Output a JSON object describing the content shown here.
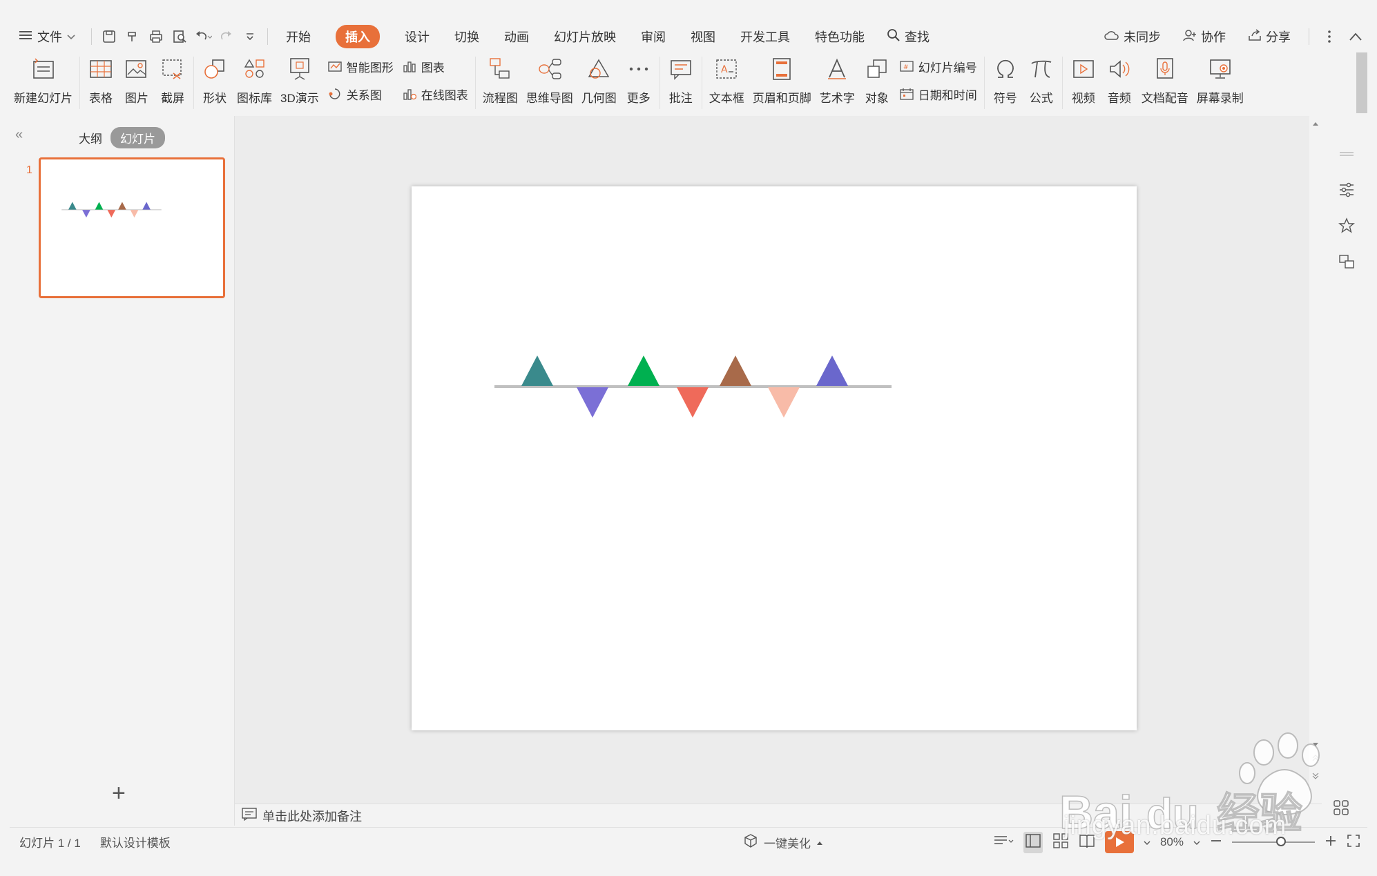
{
  "menu": {
    "file_label": "文件",
    "tabs": [
      "开始",
      "插入",
      "设计",
      "切换",
      "动画",
      "幻灯片放映",
      "审阅",
      "视图",
      "开发工具",
      "特色功能"
    ],
    "active_tab": "插入",
    "search_label": "查找",
    "sync_label": "未同步",
    "collab_label": "协作",
    "share_label": "分享"
  },
  "ribbon": {
    "new_slide": "新建幻灯片",
    "table": "表格",
    "picture": "图片",
    "screenshot": "截屏",
    "shape": "形状",
    "icon_library": "图标库",
    "demo_3d": "3D演示",
    "smart_art": "智能图形",
    "chart": "图表",
    "relation": "关系图",
    "online_chart": "在线图表",
    "flowchart": "流程图",
    "mindmap": "思维导图",
    "geometry": "几何图",
    "more": "更多",
    "comment": "批注",
    "textbox": "文本框",
    "header_footer": "页眉和页脚",
    "wordart": "艺术字",
    "object": "对象",
    "slide_number": "幻灯片编号",
    "date_time": "日期和时间",
    "symbol": "符号",
    "formula": "公式",
    "video": "视频",
    "audio": "音频",
    "doc_voice": "文档配音",
    "screen_record": "屏幕录制"
  },
  "panel": {
    "tab_outline": "大纲",
    "tab_slides": "幻灯片",
    "slide_number": "1"
  },
  "notes": {
    "placeholder": "单击此处添加备注"
  },
  "status": {
    "slide_info": "幻灯片 1 / 1",
    "template": "默认设计模板",
    "beautify": "一键美化",
    "zoom": "80%"
  },
  "watermark": {
    "brand": "Baidu经验",
    "url": "jingyan.baidu.com"
  },
  "colors": {
    "accent": "#e8703a",
    "line": "#c0c0c0",
    "teal": "#3a8a8c",
    "purple": "#7b6fd6",
    "green": "#00b050",
    "coral": "#ef6a5a",
    "brown": "#a86a4a",
    "peach": "#f8bba8",
    "indigo": "#6a67cc"
  },
  "slide_flags": [
    {
      "dir": "up",
      "color": "#3a8a8c"
    },
    {
      "dir": "down",
      "color": "#7b6fd6"
    },
    {
      "dir": "up",
      "color": "#00b050"
    },
    {
      "dir": "down",
      "color": "#ef6a5a"
    },
    {
      "dir": "up",
      "color": "#a86a4a"
    },
    {
      "dir": "down",
      "color": "#f8bba8"
    },
    {
      "dir": "up",
      "color": "#6a67cc"
    }
  ]
}
